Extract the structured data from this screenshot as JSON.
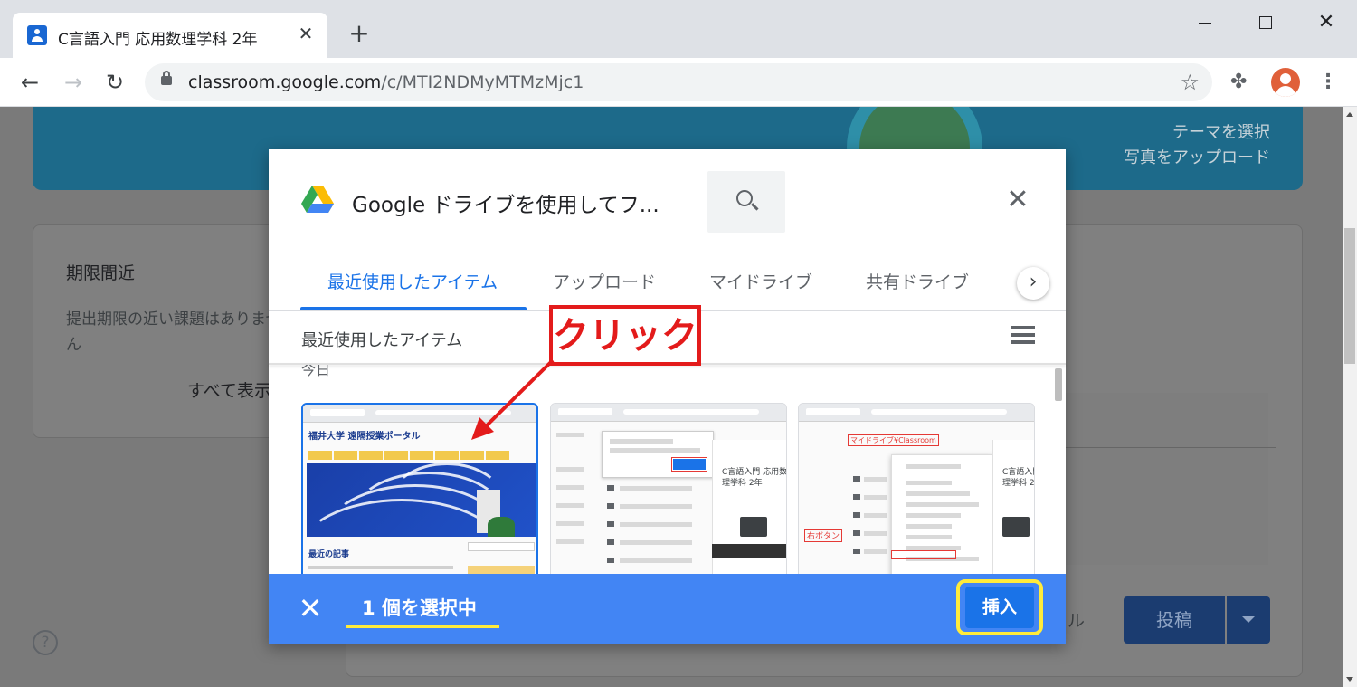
{
  "browser": {
    "tab_title": "C言語入門 応用数理学科 2年",
    "url_domain": "classroom.google.com",
    "url_path": "/c/MTI2NDMyMTMzMjc1"
  },
  "background_page": {
    "banner_links": [
      "テーマを選択",
      "写真をアップロード"
    ],
    "upcoming": {
      "title": "期限間近",
      "text": "提出期限の近い課題はありません",
      "view_all": "すべて表示"
    },
    "stream_suffix": "ル",
    "post_label": "投稿"
  },
  "picker": {
    "title": "Google ドライブを使用してフ...",
    "tabs": [
      {
        "label": "最近使用したアイテム",
        "active": true
      },
      {
        "label": "アップロード",
        "active": false
      },
      {
        "label": "マイドライブ",
        "active": false
      },
      {
        "label": "共有ドライブ",
        "active": false
      }
    ],
    "section_header": "最近使用したアイテム",
    "group_label": "今日",
    "thumbnails": [
      {
        "selected": true,
        "heading": "福井大学 遠隔授業ポータル",
        "news_heading": "最近の記事"
      },
      {
        "selected": false,
        "panel_text": "C言語入門 応用数理学科 2年"
      },
      {
        "selected": false,
        "red_label": "マイドライブ¥Classroom",
        "right_click_label": "右ボタン",
        "panel_text": "C言語入門 応用数理学科 2年"
      }
    ],
    "action_bar": {
      "selected_count": "1 個を選択中",
      "insert_label": "挿入"
    }
  },
  "annotation": {
    "label": "クリック",
    "color": "#e31b1b"
  },
  "colors": {
    "accent": "#1a73e8",
    "action_bar": "#4285f4",
    "highlight_yellow": "#ffeb3b"
  }
}
